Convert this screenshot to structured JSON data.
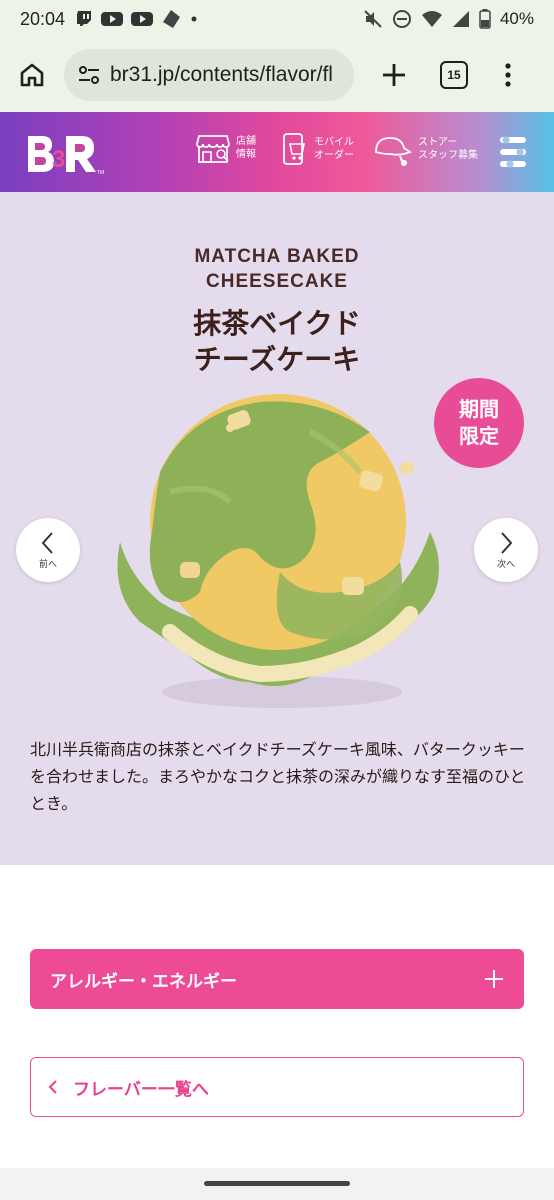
{
  "status_bar": {
    "time": "20:04",
    "battery": "40%",
    "left_icons": [
      "twitch-icon",
      "youtube-icon",
      "youtube-icon",
      "app-icon",
      "dot-icon"
    ],
    "right_icons": [
      "mute-icon",
      "dnd-icon",
      "wifi-icon",
      "signal-icon",
      "battery-icon"
    ]
  },
  "browser": {
    "url": "br31.jp/contents/flavor/fl",
    "tab_count": "15"
  },
  "site_header": {
    "logo": "BR",
    "nav": [
      {
        "label": "店舗\n情報",
        "icon": "store-icon"
      },
      {
        "label": "モバイル\nオーダー",
        "icon": "mobile-order-icon"
      },
      {
        "label": "ストアー\nスタッフ募集",
        "icon": "cap-icon"
      }
    ]
  },
  "flavor": {
    "name_en": "MATCHA BAKED\nCHEESECAKE",
    "name_jp": "抹茶ベイクド\nチーズケーキ",
    "badge": "期間\n限定",
    "prev_label": "前へ",
    "next_label": "次へ",
    "description": "北川半兵衛商店の抹茶とベイクドチーズケーキ風味、バタークッキーを合わせました。まろやかなコクと抹茶の深みが織りなす至福のひととき。"
  },
  "buttons": {
    "allergy": "アレルギー・エネルギー",
    "flavor_list": "フレーバー一覧へ"
  },
  "colors": {
    "accent": "#ee4b97",
    "hero_bg": "#e4dcec",
    "browser_bg": "#eef3e8"
  }
}
